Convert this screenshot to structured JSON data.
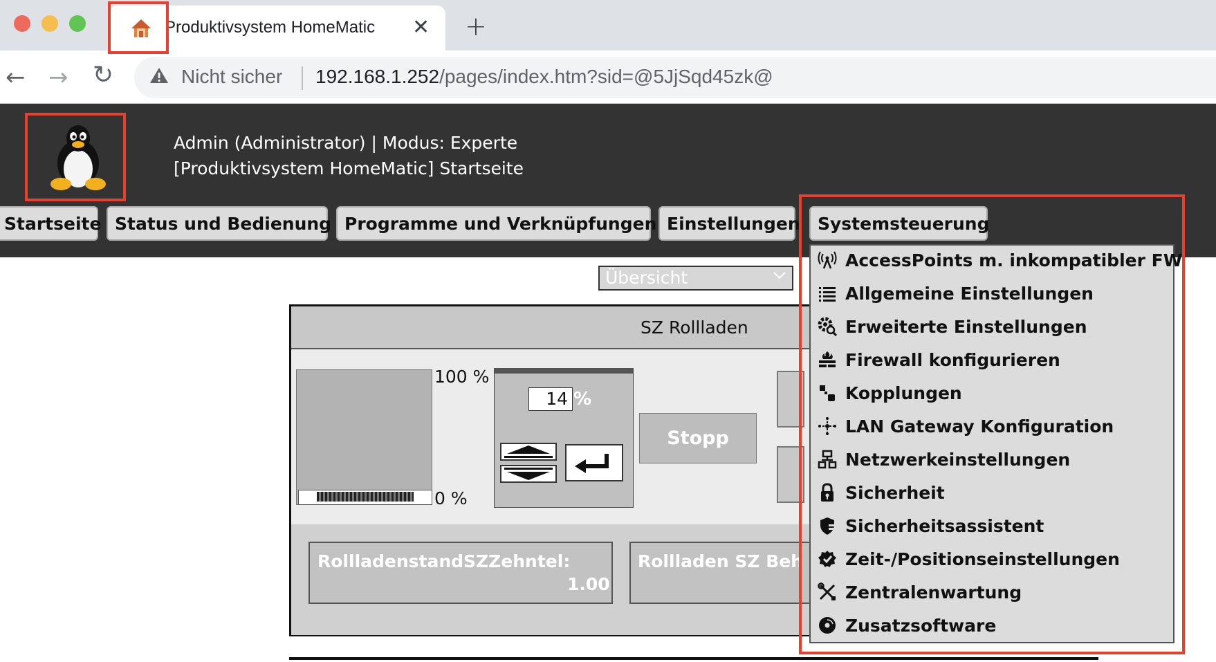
{
  "browser": {
    "tab_title": "Produktivsystem HomeMatic",
    "tab_close": "✕",
    "new_tab": "+",
    "security_label": "Nicht sicher",
    "url_host": "192.168.1.252",
    "url_path": "/pages/index.htm?sid=@5JjSqd45zk@",
    "nav": {
      "back": "←",
      "forward": "→",
      "reload": "↻"
    }
  },
  "header": {
    "user_line": "Admin (Administrator) | Modus: Experte",
    "page_line": "[Produktivsystem HomeMatic] Startseite"
  },
  "nav_tabs": [
    {
      "label": "Startseite"
    },
    {
      "label": "Status und Bedienung"
    },
    {
      "label": "Programme und Verknüpfungen"
    },
    {
      "label": "Einstellungen"
    },
    {
      "label": "Systemsteuerung"
    }
  ],
  "content": {
    "view_select": "Übersicht",
    "panel_title": "SZ Rollladen",
    "scale_max": "100 %",
    "scale_min": "0 %",
    "level_value": "14",
    "level_unit": "%",
    "stop_label": "Stopp",
    "tile1_label": "RollladenstandSZZehntel:",
    "tile1_value": "1.00",
    "tile2_label": "Rollladen SZ Behang"
  },
  "dropdown": {
    "items": [
      {
        "label": "AccessPoints m. inkompatibler FW",
        "icon": "antenna-icon"
      },
      {
        "label": "Allgemeine Einstellungen",
        "icon": "list-icon"
      },
      {
        "label": "Erweiterte Einstellungen",
        "icon": "gear-search-icon"
      },
      {
        "label": "Firewall konfigurieren",
        "icon": "firewall-icon"
      },
      {
        "label": "Kopplungen",
        "icon": "pairing-icon"
      },
      {
        "label": "LAN Gateway Konfiguration",
        "icon": "network-hub-icon"
      },
      {
        "label": "Netzwerkeinstellungen",
        "icon": "network-icon"
      },
      {
        "label": "Sicherheit",
        "icon": "lock-icon"
      },
      {
        "label": "Sicherheitsassistent",
        "icon": "shield-icon"
      },
      {
        "label": "Zeit-/Positionseinstellungen",
        "icon": "badge-check-icon"
      },
      {
        "label": "Zentralenwartung",
        "icon": "tools-icon"
      },
      {
        "label": "Zusatzsoftware",
        "icon": "disc-icon"
      }
    ]
  },
  "colors": {
    "header_bg": "#333333",
    "highlight_red": "#e8402e"
  }
}
